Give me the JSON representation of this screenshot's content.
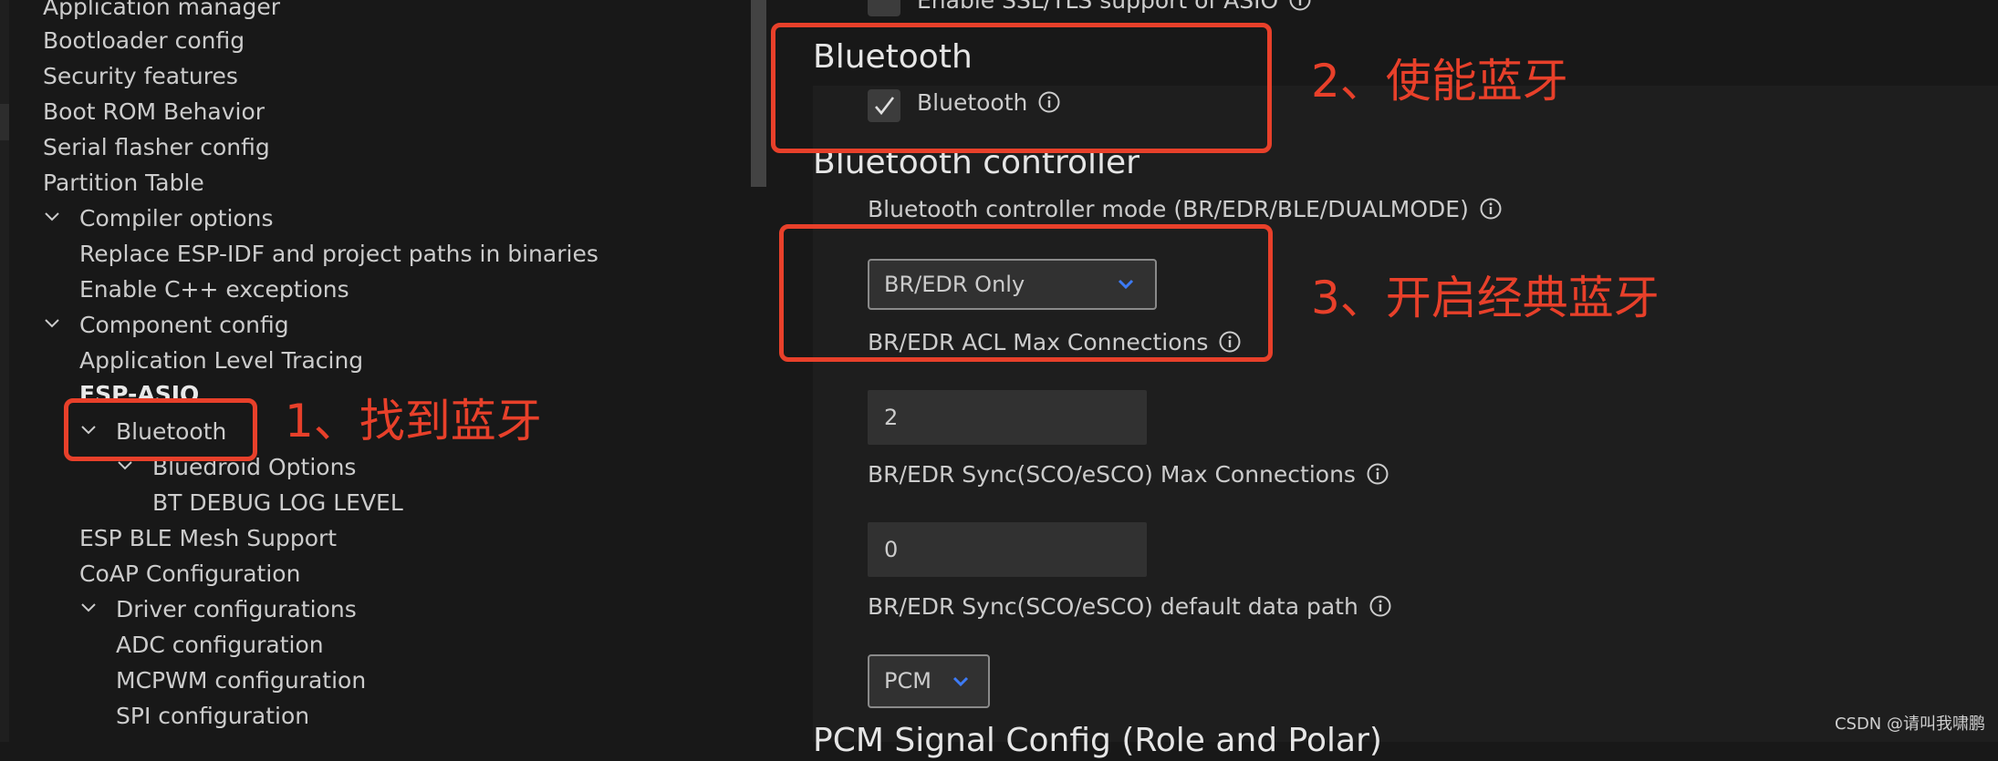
{
  "sidebar": {
    "items": [
      {
        "label": "Application manager"
      },
      {
        "label": "Bootloader config"
      },
      {
        "label": "Security features"
      },
      {
        "label": "Boot ROM Behavior"
      },
      {
        "label": "Serial flasher config"
      },
      {
        "label": "Partition Table"
      },
      {
        "label": "Compiler options"
      },
      {
        "label": "Replace ESP-IDF and project paths in binaries"
      },
      {
        "label": "Enable C++ exceptions"
      },
      {
        "label": "Component config"
      },
      {
        "label": "Application Level Tracing"
      },
      {
        "label": "ESP-ASIO"
      },
      {
        "label": "Bluetooth"
      },
      {
        "label": "Bluedroid Options"
      },
      {
        "label": "BT DEBUG LOG LEVEL"
      },
      {
        "label": "ESP BLE Mesh Support"
      },
      {
        "label": "CoAP Configuration"
      },
      {
        "label": "Driver configurations"
      },
      {
        "label": "ADC configuration"
      },
      {
        "label": "MCPWM configuration"
      },
      {
        "label": "SPI configuration"
      }
    ]
  },
  "settings": {
    "top_partial_label": "Enable SSL/TLS support of ASIO",
    "bluetooth_section": {
      "title": "Bluetooth",
      "checkbox_label": "Bluetooth",
      "checked": true
    },
    "controller_section": {
      "title": "Bluetooth controller",
      "mode_label": "Bluetooth controller mode (BR/EDR/BLE/DUALMODE)",
      "mode_value": "BR/EDR Only",
      "acl_label": "BR/EDR ACL Max Connections",
      "acl_value": "2",
      "sync_label": "BR/EDR Sync(SCO/eSCO) Max Connections",
      "sync_value": "0",
      "path_label": "BR/EDR Sync(SCO/eSCO) default data path",
      "path_value": "PCM"
    },
    "pcm_section": {
      "title": "PCM Signal Config (Role and Polar)"
    }
  },
  "annotations": {
    "step1": "1、找到蓝牙",
    "step2": "2、使能蓝牙",
    "step3": "3、开启经典蓝牙"
  },
  "watermark": "CSDN @请叫我啸鹏",
  "colors": {
    "background": "#181818",
    "panel": "#1e1e1e",
    "annotation_red": "#e8402a",
    "accent_blue": "#3d7bf5"
  }
}
